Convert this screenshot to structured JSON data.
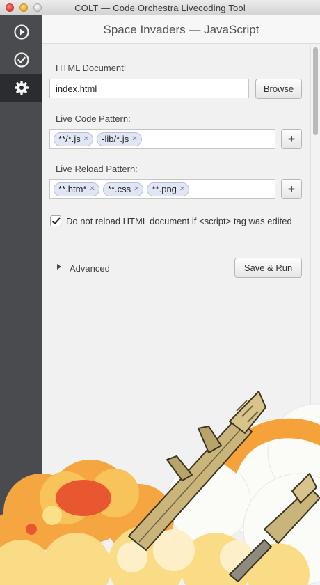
{
  "window": {
    "title": "COLT — Code Orchestra Livecoding Tool"
  },
  "sidebar": {
    "items": [
      {
        "name": "run",
        "icon": "play-circle-icon"
      },
      {
        "name": "check",
        "icon": "checkmark-circle-icon"
      },
      {
        "name": "settings",
        "icon": "gear-icon",
        "active": true
      }
    ]
  },
  "header": {
    "title": "Space Invaders — JavaScript"
  },
  "form": {
    "html_document": {
      "label": "HTML Document:",
      "value": "index.html",
      "browse_label": "Browse"
    },
    "live_code": {
      "label": "Live Code Pattern:",
      "tags": [
        "**/*.js",
        "-lib/*.js"
      ],
      "add_label": "+"
    },
    "live_reload": {
      "label": "Live Reload Pattern:",
      "tags": [
        "**.htm*",
        "**.css",
        "**.png"
      ],
      "add_label": "+"
    },
    "no_reload": {
      "label": "Do not reload HTML document if <script> tag was edited",
      "checked": true
    },
    "advanced_label": "Advanced",
    "save_run_label": "Save & Run"
  },
  "colors": {
    "sidebar": "#4a4b4f",
    "sidebar_active": "#2b2c2f",
    "tag_bg": "#e2e6f4"
  }
}
